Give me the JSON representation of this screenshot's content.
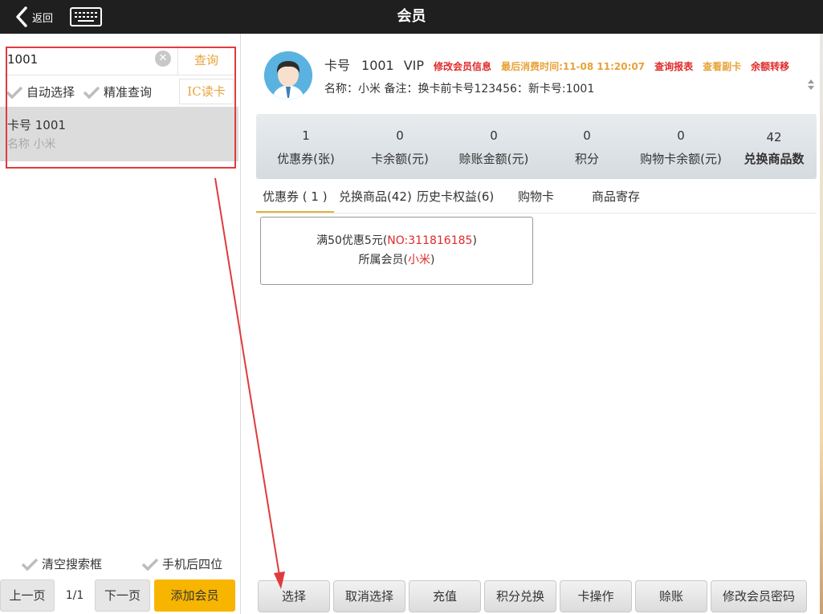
{
  "header": {
    "back_label": "返回",
    "title": "会员"
  },
  "search": {
    "value": "1001",
    "query_label": "查询",
    "auto_select_label": "自动选择",
    "exact_query_label": "精准查询",
    "ic_read_label": "IC读卡"
  },
  "member_list": [
    {
      "card": "卡号 1001",
      "name": "名称 小米"
    }
  ],
  "left_bottom": {
    "clear_search_label": "清空搜索框",
    "phone_last4_label": "手机后四位",
    "prev_label": "上一页",
    "page_label": "1/1",
    "next_label": "下一页",
    "add_member_label": "添加会员"
  },
  "member": {
    "card_label": "卡号",
    "card_no": "1001",
    "level": "VIP",
    "edit_info_link": "修改会员信息",
    "last_consume": "最后消费时间:11-08 11:20:07",
    "query_report_link": "查询报表",
    "view_sub_card_link": "查看副卡",
    "balance_transfer_link": "余额转移",
    "detail_line": "名称：小米 备注：换卡前卡号123456：新卡号:1001"
  },
  "stats": [
    {
      "value": "1",
      "label": "优惠券(张)"
    },
    {
      "value": "0",
      "label": "卡余额(元)"
    },
    {
      "value": "0",
      "label": "赊账金额(元)"
    },
    {
      "value": "0",
      "label": "积分"
    },
    {
      "value": "0",
      "label": "购物卡余额(元)"
    },
    {
      "value": "42",
      "label": "兑换商品数"
    }
  ],
  "tabs": [
    {
      "label": "优惠券 ( 1 )"
    },
    {
      "label": "兑换商品(42)"
    },
    {
      "label": "历史卡权益(6)"
    },
    {
      "label": "购物卡"
    },
    {
      "label": "商品寄存"
    }
  ],
  "coupon": {
    "title": "满50优惠5元",
    "no_prefix": "(",
    "no": "NO:311816185",
    "no_suffix": ")",
    "owner_prefix": "所属会员(",
    "owner": "小米",
    "owner_suffix": ")"
  },
  "actions": [
    {
      "label": "选择"
    },
    {
      "label": "取消选择"
    },
    {
      "label": "充值"
    },
    {
      "label": "积分兑换"
    },
    {
      "label": "卡操作"
    },
    {
      "label": "赊账"
    },
    {
      "label": "修改会员密码"
    }
  ],
  "colors": {
    "accent_orange": "#e8a33a",
    "link_red": "#e02a2a",
    "add_button_yellow": "#f7b500",
    "annotation_red": "#e03b3b",
    "topbar": "#1f1f1f"
  },
  "icons": {
    "back": "chevron-left-icon",
    "keyboard": "keyboard-icon",
    "clear": "clear-icon",
    "check": "check-icon",
    "avatar": "avatar-icon"
  }
}
